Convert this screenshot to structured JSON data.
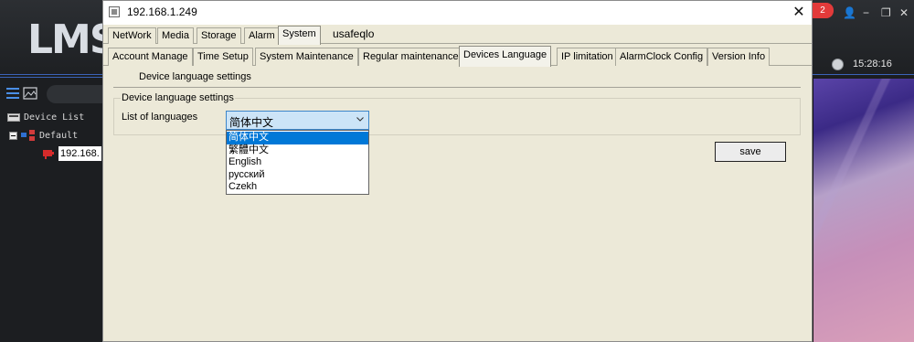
{
  "background_app": {
    "logo": "LMS",
    "notification_count": "2",
    "clock": "15:28:16",
    "tree": {
      "device_list_label": "Device List",
      "group_label": "Default",
      "device_ip": "192.168."
    }
  },
  "dialog": {
    "title": "192.168.1.249",
    "close_glyph": "✕",
    "top_tabs": [
      "NetWork",
      "Media",
      "Storage",
      "Alarm",
      "System"
    ],
    "active_top_tab": "System",
    "user_label": "usafeqlo",
    "sub_tabs": [
      "Account Manage",
      "Time Setup",
      "System Maintenance",
      "Regular maintenance",
      "Devices Language",
      "IP limitation",
      "AlarmClock Config",
      "Version Info"
    ],
    "active_sub_tab": "Devices Language",
    "section_caption": "Device language settings",
    "group_title": "Device language settings",
    "list_label": "List of languages",
    "select": {
      "value": "简体中文",
      "options": [
        "简体中文",
        "繁體中文",
        "English",
        "русский",
        "Czekh"
      ],
      "highlighted_option": "简体中文"
    },
    "save_label": "save"
  },
  "colors": {
    "dialog_bg": "#ece9d8",
    "select_bg": "#cce4f7",
    "highlight": "#0078d7",
    "badge": "#e23a3a"
  }
}
